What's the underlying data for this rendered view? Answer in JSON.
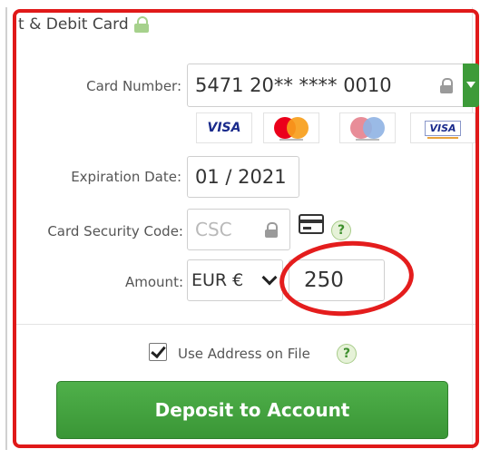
{
  "title": "t & Debit Card",
  "fields": {
    "card_number": {
      "label": "Card Number:",
      "value": "5471 20** **** 0010"
    },
    "expiration": {
      "label": "Expiration Date:",
      "value": "01 / 2021"
    },
    "security": {
      "label": "Card Security Code:",
      "placeholder": "CSC"
    },
    "amount": {
      "label": "Amount:",
      "currency": "EUR €",
      "value": "250"
    }
  },
  "card_logos": [
    "VISA",
    "mastercard",
    "maestro",
    "VISA"
  ],
  "use_address": {
    "label": "Use Address on File",
    "checked": true
  },
  "help_symbol": "?",
  "deposit_button": {
    "label": "Deposit to Account"
  },
  "colors": {
    "accent_green": "#3d9b39",
    "annotation_red": "#e01919"
  }
}
